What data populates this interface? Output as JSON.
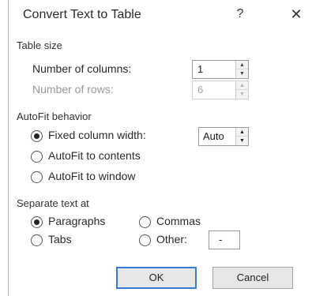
{
  "dialog": {
    "title": "Convert Text to Table",
    "help_glyph": "?",
    "close_glyph": "✕"
  },
  "table_size": {
    "heading": "Table size",
    "columns_label": "Number of columns:",
    "columns_value": "1",
    "rows_label": "Number of rows:",
    "rows_value": "6"
  },
  "autofit": {
    "heading": "AutoFit behavior",
    "fixed_label": "Fixed column width:",
    "fixed_value": "Auto",
    "contents_label": "AutoFit to contents",
    "window_label": "AutoFit to window",
    "selected": "fixed"
  },
  "separate": {
    "heading": "Separate text at",
    "paragraphs_label": "Paragraphs",
    "commas_label": "Commas",
    "tabs_label": "Tabs",
    "other_label": "Other:",
    "other_value": "-",
    "selected": "paragraphs"
  },
  "buttons": {
    "ok_label": "OK",
    "cancel_label": "Cancel"
  },
  "spin_glyphs": {
    "up": "▲",
    "down": "▼"
  }
}
